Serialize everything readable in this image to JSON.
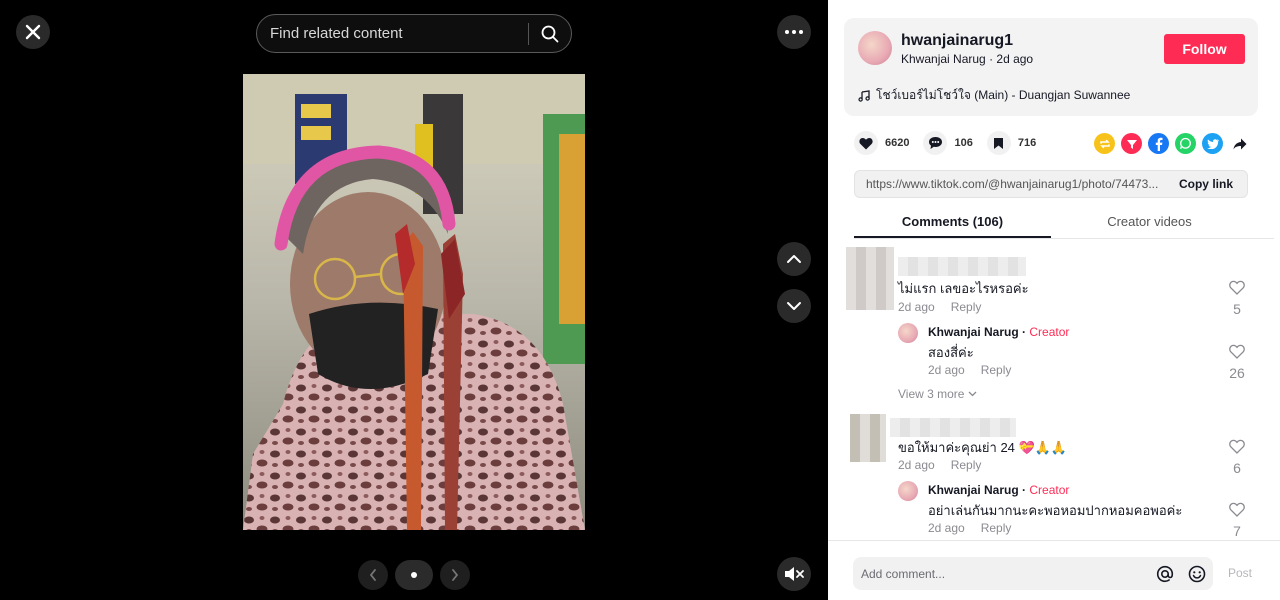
{
  "viewer": {
    "search_placeholder": "Find related content"
  },
  "author": {
    "username": "hwanjainarug1",
    "display_name": "Khwanjai Narug",
    "posted": "2d ago",
    "follow_label": "Follow",
    "music": "โชว์เบอร์ไม่โชว์ใจ (Main) - Duangjan Suwannee"
  },
  "stats": {
    "likes": "6620",
    "comments": "106",
    "saves": "716"
  },
  "share": {
    "icons": [
      "repost-icon",
      "pin-icon",
      "facebook-icon",
      "whatsapp-icon",
      "twitter-icon",
      "forward-icon"
    ],
    "colors": {
      "repost": "#f7c31a",
      "pin": "#fe2c55",
      "facebook": "#1877f2",
      "whatsapp": "#25d366",
      "twitter": "#1da1f2"
    }
  },
  "link": {
    "url": "https://www.tiktok.com/@hwanjainarug1/photo/74473...",
    "copy_label": "Copy link"
  },
  "tabs": [
    {
      "label": "Comments (106)",
      "active": true
    },
    {
      "label": "Creator videos",
      "active": false
    }
  ],
  "comments": [
    {
      "text": "ไม่แรก เลขอะไรหรอค่ะ",
      "time": "2d ago",
      "reply_label": "Reply",
      "likes": "5",
      "replies": [
        {
          "name": "Khwanjai Narug",
          "badge": "Creator",
          "text": "สองสี่ค่ะ",
          "time": "2d ago",
          "reply_label": "Reply",
          "likes": "26"
        }
      ],
      "view_more": "View 3 more"
    },
    {
      "text": "ขอให้มาค่ะคุณย่า 24 💝🙏🙏",
      "time": "2d ago",
      "reply_label": "Reply",
      "likes": "6",
      "replies": [
        {
          "name": "Khwanjai Narug",
          "badge": "Creator",
          "text": "อย่าเล่นกันมากนะคะพอหอมปากหอมคอพอค่ะ",
          "time": "2d ago",
          "reply_label": "Reply",
          "likes": "7"
        }
      ]
    }
  ],
  "composer": {
    "placeholder": "Add comment...",
    "post_label": "Post"
  },
  "brand_color": "#fe2c55"
}
